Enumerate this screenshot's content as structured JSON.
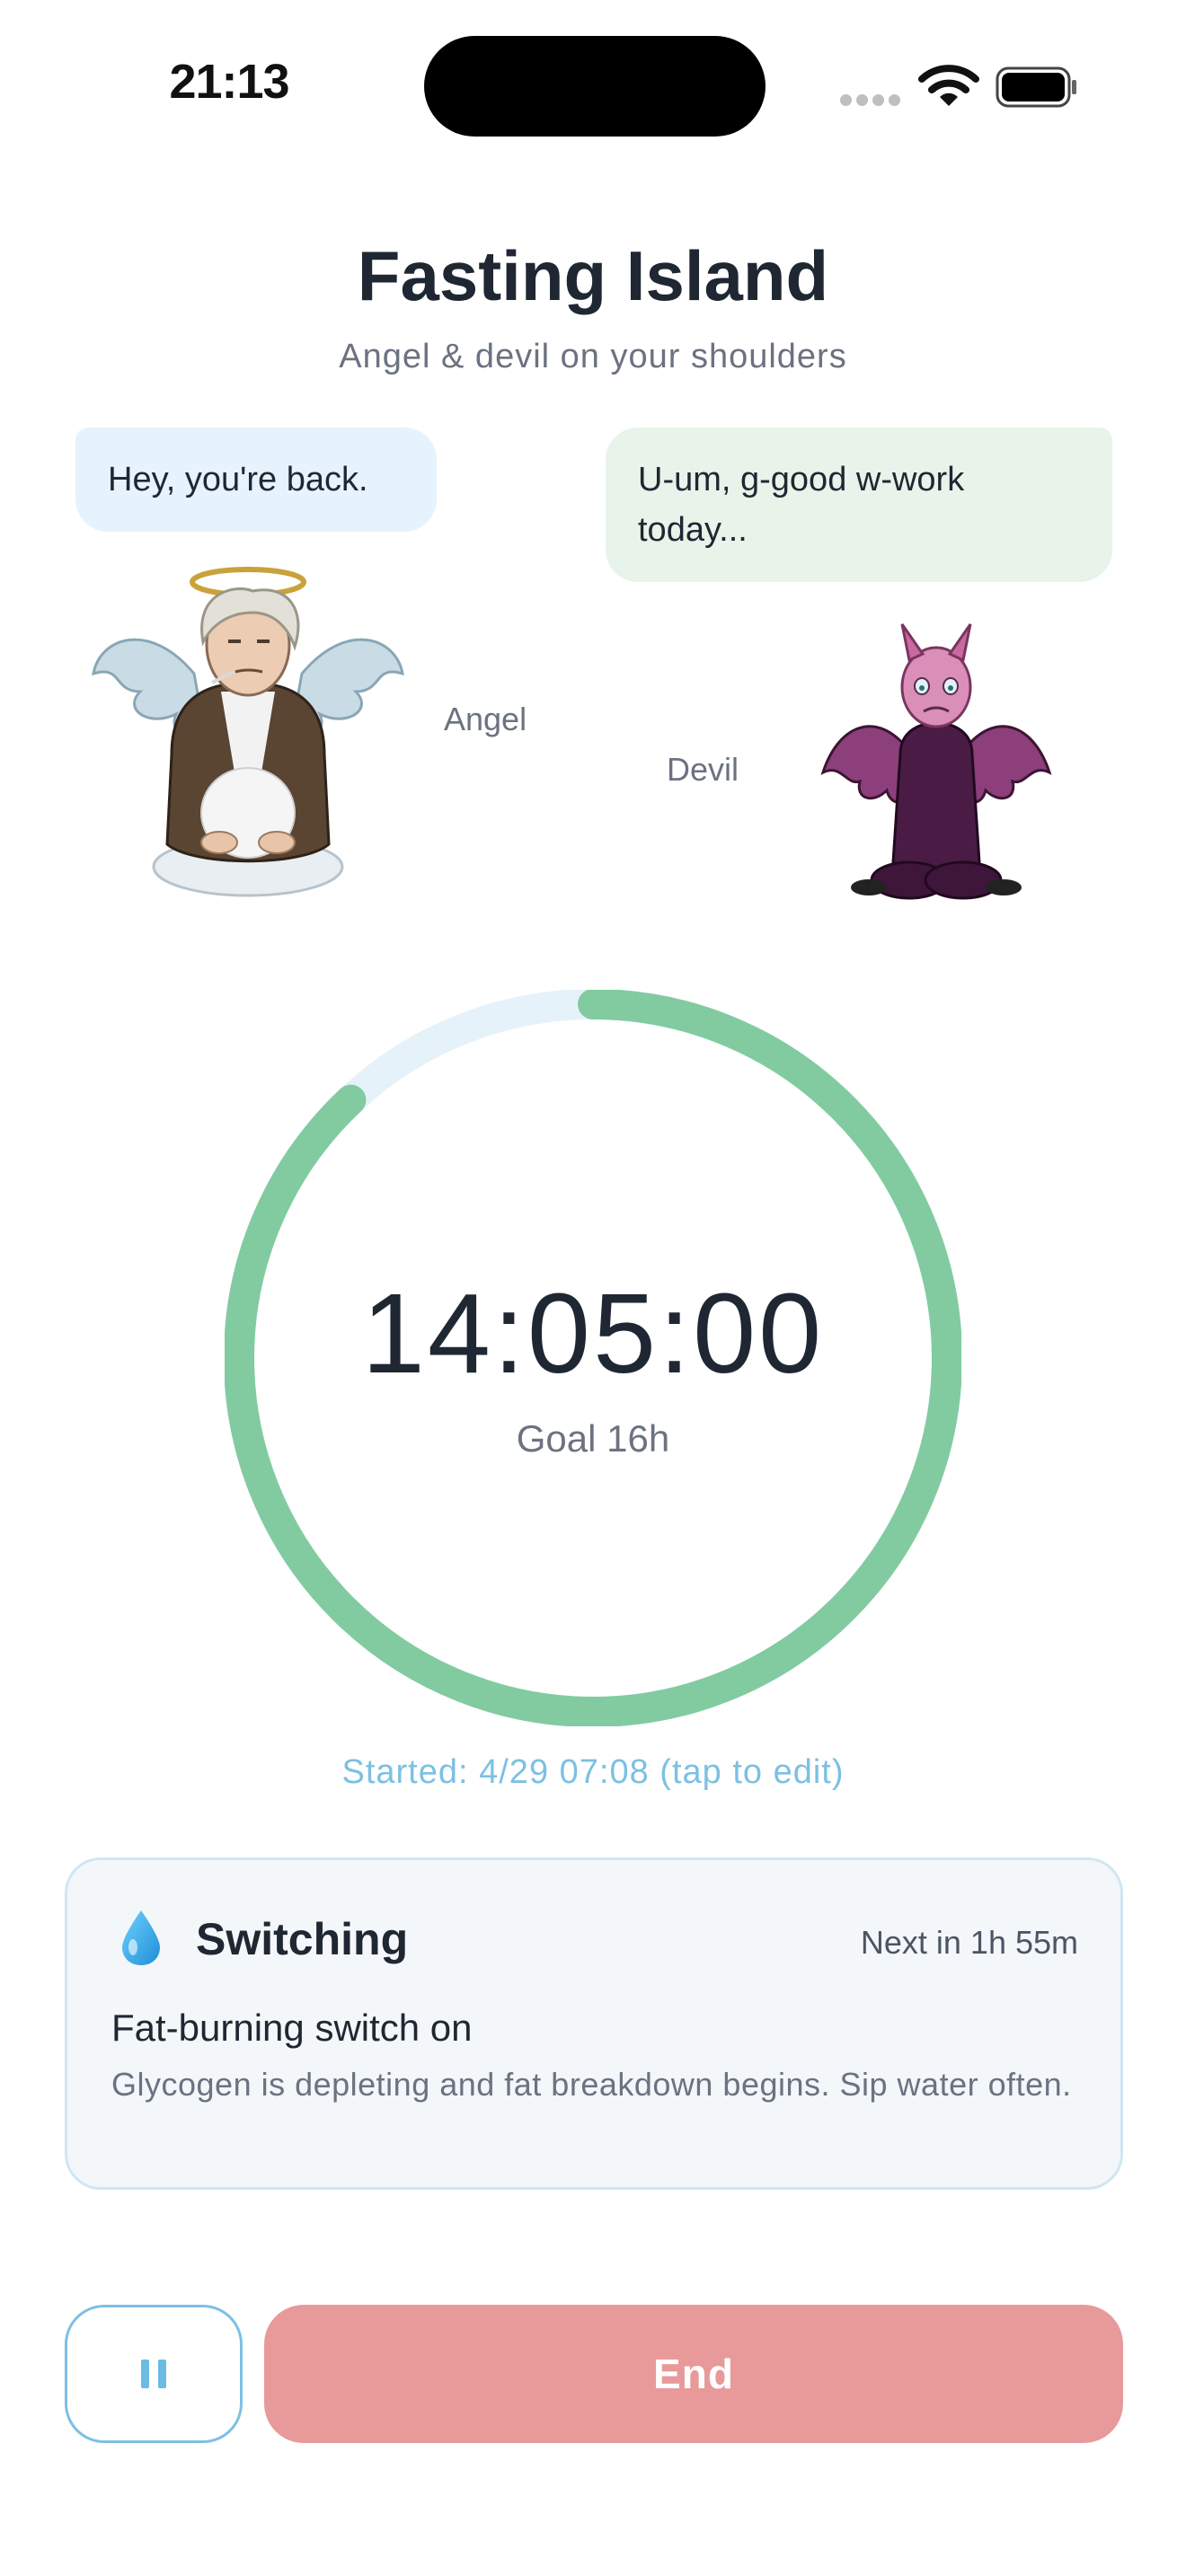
{
  "status_bar": {
    "time": "21:13",
    "icons": [
      "signal-dots-icon",
      "wifi-icon",
      "battery-icon"
    ]
  },
  "header": {
    "title": "Fasting Island",
    "subtitle": "Angel & devil on your shoulders"
  },
  "characters": {
    "angel": {
      "label": "Angel",
      "speech": "Hey, you're back.",
      "bubble_color": "#e6f3fc"
    },
    "devil": {
      "label": "Devil",
      "speech": "U-um, g-good w-work today...",
      "bubble_color": "#e8f4ea"
    }
  },
  "timer": {
    "elapsed": "14:05:00",
    "goal_label": "Goal 16h",
    "progress_fraction": 0.88,
    "started_text": "Started: 4/29 07:08 (tap to edit)"
  },
  "phase": {
    "icon": "water-drop-icon",
    "name": "Switching",
    "next": "Next in 1h 55m",
    "headline": "Fat-burning switch on",
    "description": "Glycogen is depleting and fat breakdown begins. Sip water often."
  },
  "actions": {
    "pause_icon": "pause-icon",
    "end_label": "End"
  },
  "colors": {
    "progress": "#82cba0",
    "track": "#e6f2fa",
    "accent": "#7cc0e4",
    "end_button": "#e89a9a",
    "text_primary": "#1f2733",
    "text_secondary": "#6b7280"
  }
}
